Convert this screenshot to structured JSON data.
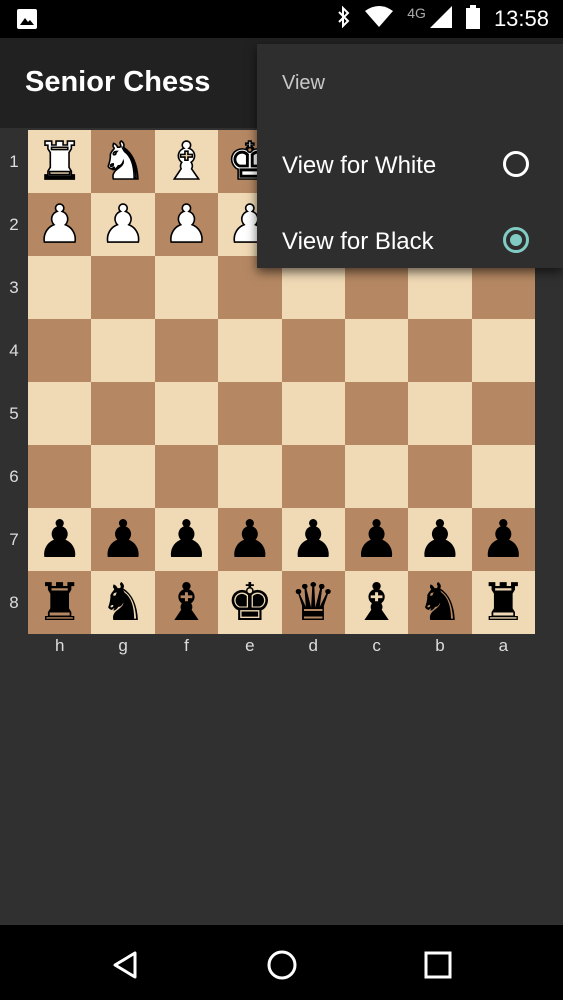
{
  "status_bar": {
    "time": "13:58",
    "network": "4G",
    "icons": [
      "image-icon",
      "bluetooth-icon",
      "wifi-icon",
      "signal-icon",
      "battery-icon"
    ]
  },
  "app_bar": {
    "title": "Senior Chess"
  },
  "board": {
    "ranks": [
      "1",
      "2",
      "3",
      "4",
      "5",
      "6",
      "7",
      "8"
    ],
    "files": [
      "h",
      "g",
      "f",
      "e",
      "d",
      "c",
      "b",
      "a"
    ],
    "rows": [
      [
        "♜",
        "♞",
        "♝",
        "♚",
        "",
        "",
        "",
        ""
      ],
      [
        "♟",
        "♟",
        "♟",
        "♟",
        "",
        "",
        "",
        ""
      ],
      [
        "",
        "",
        "",
        "",
        "",
        "",
        "",
        ""
      ],
      [
        "",
        "",
        "",
        "",
        "",
        "",
        "",
        ""
      ],
      [
        "",
        "",
        "",
        "",
        "",
        "",
        "",
        ""
      ],
      [
        "",
        "",
        "",
        "",
        "",
        "",
        "",
        ""
      ],
      [
        "♟",
        "♟",
        "♟",
        "♟",
        "♟",
        "♟",
        "♟",
        "♟"
      ],
      [
        "♜",
        "♞",
        "♝",
        "♚",
        "♛",
        "♝",
        "♞",
        "♜"
      ]
    ],
    "colors": [
      [
        "white",
        "white",
        "white",
        "white",
        "",
        "",
        "",
        ""
      ],
      [
        "white",
        "white",
        "white",
        "white",
        "",
        "",
        "",
        ""
      ],
      [
        "",
        "",
        "",
        "",
        "",
        "",
        "",
        ""
      ],
      [
        "",
        "",
        "",
        "",
        "",
        "",
        "",
        ""
      ],
      [
        "",
        "",
        "",
        "",
        "",
        "",
        "",
        ""
      ],
      [
        "",
        "",
        "",
        "",
        "",
        "",
        "",
        ""
      ],
      [
        "black",
        "black",
        "black",
        "black",
        "black",
        "black",
        "black",
        "black"
      ],
      [
        "black",
        "black",
        "black",
        "black",
        "black",
        "black",
        "black",
        "black"
      ]
    ],
    "light_square": "#f0d9b5",
    "dark_square": "#b58863"
  },
  "menu": {
    "title": "View",
    "items": [
      {
        "label": "View for White",
        "checked": false
      },
      {
        "label": "View for Black",
        "checked": true
      }
    ],
    "accent": "#80cbc4"
  },
  "nav_bar": {
    "icons": [
      "back-icon",
      "home-icon",
      "recents-icon"
    ]
  }
}
